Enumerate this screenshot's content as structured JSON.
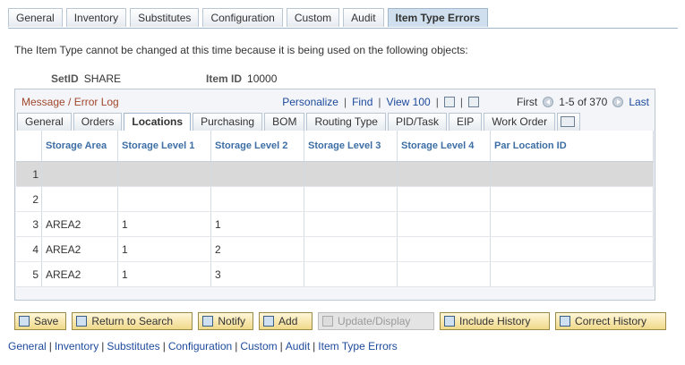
{
  "top_tabs": [
    {
      "label": "General"
    },
    {
      "label": "Inventory"
    },
    {
      "label": "Substitutes"
    },
    {
      "label": "Configuration"
    },
    {
      "label": "Custom"
    },
    {
      "label": "Audit"
    },
    {
      "label": "Item Type Errors",
      "active": true
    }
  ],
  "message": "The Item Type cannot be changed at this time because it is being used on the following objects:",
  "setid": {
    "label": "SetID",
    "value": "SHARE"
  },
  "itemid": {
    "label": "Item ID",
    "value": "10000"
  },
  "grid": {
    "title": "Message / Error Log",
    "personalize": "Personalize",
    "find": "Find",
    "view": "View 100",
    "first": "First",
    "range": "1-5 of 370",
    "last": "Last"
  },
  "sub_tabs": [
    {
      "label": "General"
    },
    {
      "label": "Orders"
    },
    {
      "label": "Locations",
      "active": true
    },
    {
      "label": "Purchasing"
    },
    {
      "label": "BOM"
    },
    {
      "label": "Routing Type"
    },
    {
      "label": "PID/Task"
    },
    {
      "label": "EIP"
    },
    {
      "label": "Work Order"
    }
  ],
  "columns": [
    "Storage Area",
    "Storage Level 1",
    "Storage Level 2",
    "Storage Level 3",
    "Storage Level 4",
    "Par Location ID"
  ],
  "rows": [
    {
      "n": "1",
      "area": "",
      "l1": "",
      "l2": "",
      "l3": "",
      "l4": "",
      "par": ""
    },
    {
      "n": "2",
      "area": "",
      "l1": "",
      "l2": "",
      "l3": "",
      "l4": "",
      "par": ""
    },
    {
      "n": "3",
      "area": "AREA2",
      "l1": "1",
      "l2": "1",
      "l3": "",
      "l4": "",
      "par": ""
    },
    {
      "n": "4",
      "area": "AREA2",
      "l1": "1",
      "l2": "2",
      "l3": "",
      "l4": "",
      "par": ""
    },
    {
      "n": "5",
      "area": "AREA2",
      "l1": "1",
      "l2": "3",
      "l3": "",
      "l4": "",
      "par": ""
    }
  ],
  "buttons": {
    "save": "Save",
    "return": "Return to Search",
    "notify": "Notify",
    "add": "Add",
    "update": "Update/Display",
    "include": "Include History",
    "correct": "Correct History"
  },
  "bottom_links": [
    "General",
    "Inventory",
    "Substitutes",
    "Configuration",
    "Custom",
    "Audit",
    "Item Type Errors"
  ]
}
